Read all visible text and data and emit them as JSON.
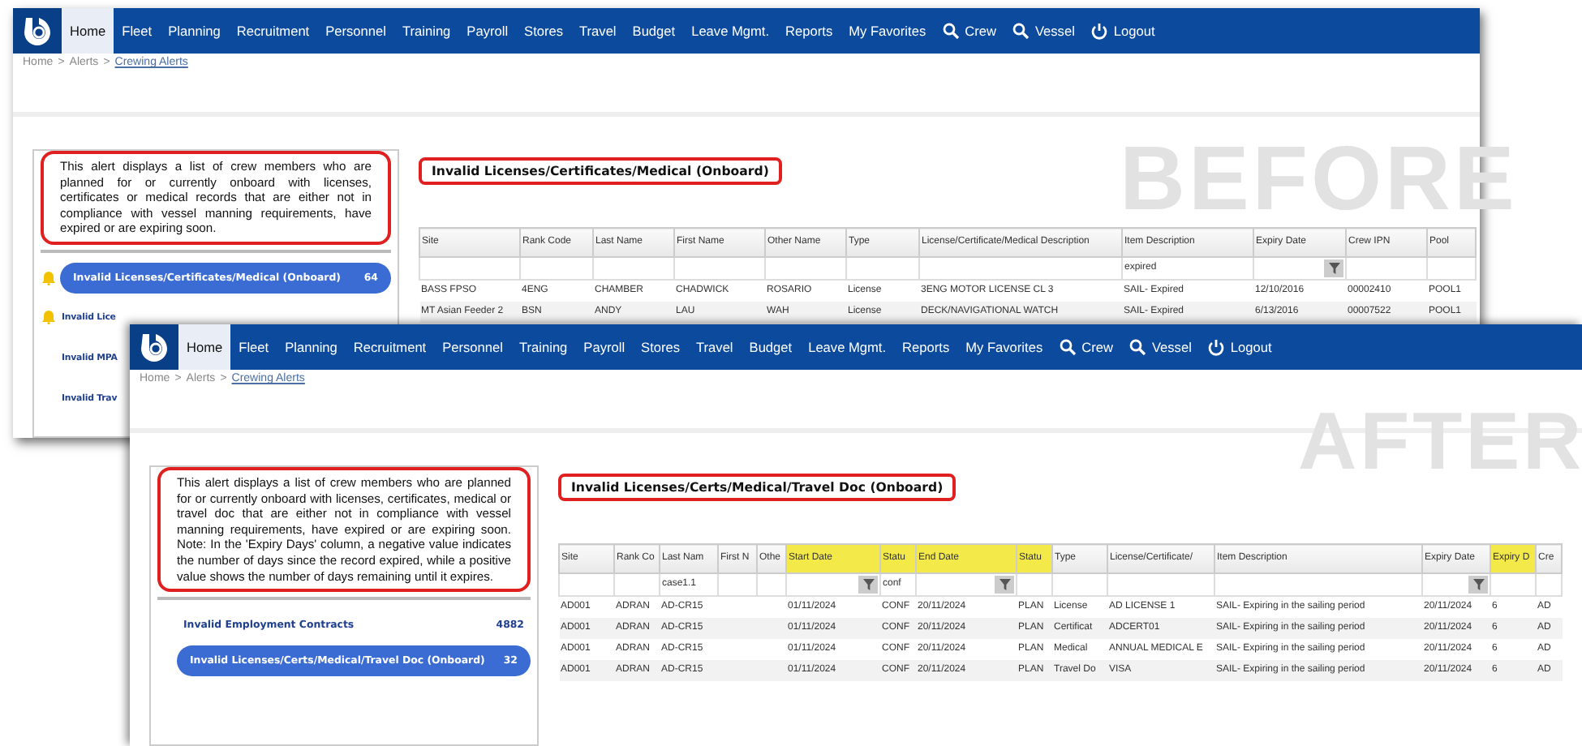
{
  "stamps": [
    {
      "kind": "before",
      "text": "BEFORE"
    },
    {
      "kind": "after",
      "text": "AFTER"
    }
  ],
  "windows": [
    {
      "nav": [
        {
          "label": "Home",
          "selected": true,
          "kind": "text"
        },
        {
          "label": "Fleet",
          "selected": false,
          "kind": "text"
        },
        {
          "label": "Planning",
          "selected": false,
          "kind": "text"
        },
        {
          "label": "Recruitment",
          "selected": false,
          "kind": "text"
        },
        {
          "label": "Personnel",
          "selected": false,
          "kind": "text"
        },
        {
          "label": "Training",
          "selected": false,
          "kind": "text"
        },
        {
          "label": "Payroll",
          "selected": false,
          "kind": "text"
        },
        {
          "label": "Stores",
          "selected": false,
          "kind": "text"
        },
        {
          "label": "Travel",
          "selected": false,
          "kind": "text"
        },
        {
          "label": "Budget",
          "selected": false,
          "kind": "text"
        },
        {
          "label": "Leave Mgmt.",
          "selected": false,
          "kind": "text"
        },
        {
          "label": "Reports",
          "selected": false,
          "kind": "text"
        },
        {
          "label": "My Favorites",
          "selected": false,
          "kind": "text"
        },
        {
          "label": "Crew",
          "selected": false,
          "kind": "search"
        },
        {
          "label": "Vessel",
          "selected": false,
          "kind": "search"
        },
        {
          "label": "Logout",
          "selected": false,
          "kind": "logout"
        }
      ],
      "breadcrumb": {
        "items": [
          "Home",
          "Alerts",
          "Crewing Alerts"
        ],
        "separator": ">"
      },
      "description": "This alert displays a list of crew members who are planned for or currently onboard with licenses, certificates or medical records that are either not in compliance with vessel manning requirements, have expired or are expiring soon.",
      "alerts": [
        {
          "label": "Invalid Licenses/Certificates/Medical (Onboard)",
          "count": "64",
          "selected": true,
          "flagged": true
        },
        {
          "label": "Invalid Lice",
          "selected": false,
          "flagged": true
        },
        {
          "label": "Invalid MPA",
          "selected": false,
          "flagged": false
        },
        {
          "label": "Invalid Trav",
          "selected": false,
          "flagged": false
        }
      ],
      "title": "Invalid Licenses/Certificates/Medical (Onboard)",
      "table": {
        "columns": [
          {
            "label": "Site",
            "highlighted": false,
            "filter_button": false
          },
          {
            "label": "Rank Code",
            "highlighted": false,
            "filter_button": false
          },
          {
            "label": "Last Name",
            "highlighted": false,
            "filter_button": false
          },
          {
            "label": "First Name",
            "highlighted": false,
            "filter_button": false
          },
          {
            "label": "Other Name",
            "highlighted": false,
            "filter_button": false
          },
          {
            "label": "Type",
            "highlighted": false,
            "filter_button": false
          },
          {
            "label": "License/Certificate/Medical Description",
            "highlighted": false,
            "filter_button": false
          },
          {
            "label": "Item Description",
            "highlighted": false,
            "filter_button": false,
            "filter": "expired"
          },
          {
            "label": "Expiry Date",
            "highlighted": false,
            "filter_button": true
          },
          {
            "label": "Crew IPN",
            "highlighted": false,
            "filter_button": false
          },
          {
            "label": "Pool",
            "highlighted": false,
            "filter_button": false
          }
        ],
        "rows": [
          [
            "BASS FPSO",
            "4ENG",
            "CHAMBER",
            "CHADWICK",
            "ROSARIO",
            "License",
            "3ENG MOTOR LICENSE CL 3",
            "SAIL- Expired",
            "12/10/2016",
            "00002410",
            "POOL1"
          ],
          [
            "MT Asian Feeder 2",
            "BSN",
            "ANDY",
            "LAU",
            "WAH",
            "License",
            "DECK/NAVIGATIONAL WATCH",
            "SAIL- Expired",
            "6/13/2016",
            "00007522",
            "POOL1"
          ]
        ]
      }
    },
    {
      "nav": [
        {
          "label": "Home",
          "selected": true,
          "kind": "text"
        },
        {
          "label": "Fleet",
          "selected": false,
          "kind": "text"
        },
        {
          "label": "Planning",
          "selected": false,
          "kind": "text"
        },
        {
          "label": "Recruitment",
          "selected": false,
          "kind": "text"
        },
        {
          "label": "Personnel",
          "selected": false,
          "kind": "text"
        },
        {
          "label": "Training",
          "selected": false,
          "kind": "text"
        },
        {
          "label": "Payroll",
          "selected": false,
          "kind": "text"
        },
        {
          "label": "Stores",
          "selected": false,
          "kind": "text"
        },
        {
          "label": "Travel",
          "selected": false,
          "kind": "text"
        },
        {
          "label": "Budget",
          "selected": false,
          "kind": "text"
        },
        {
          "label": "Leave Mgmt.",
          "selected": false,
          "kind": "text"
        },
        {
          "label": "Reports",
          "selected": false,
          "kind": "text"
        },
        {
          "label": "My Favorites",
          "selected": false,
          "kind": "text"
        },
        {
          "label": "Crew",
          "selected": false,
          "kind": "search"
        },
        {
          "label": "Vessel",
          "selected": false,
          "kind": "search"
        },
        {
          "label": "Logout",
          "selected": false,
          "kind": "logout"
        }
      ],
      "breadcrumb": {
        "items": [
          "Home",
          "Alerts",
          "Crewing Alerts"
        ],
        "separator": ">"
      },
      "description": "This alert displays a list of crew members who are planned for or currently onboard with licenses, certificates, medical or travel doc that are either not in compliance with vessel manning requirements, have expired or are expiring soon. Note: In the 'Expiry Days' column, a negative value indicates the number of days since the record expired, while a positive value shows the number of days remaining until it expires.",
      "alerts": [
        {
          "label": "Invalid Employment Contracts",
          "count": "4882",
          "selected": false,
          "flagged": false
        },
        {
          "label": "Invalid Licenses/Certs/Medical/Travel Doc (Onboard)",
          "count": "32",
          "selected": true,
          "flagged": false
        }
      ],
      "title": "Invalid Licenses/Certs/Medical/Travel Doc (Onboard)",
      "table": {
        "columns": [
          {
            "label": "Site",
            "highlighted": false,
            "filter_button": false
          },
          {
            "label": "Rank Co",
            "highlighted": false,
            "filter_button": false
          },
          {
            "label": "Last Nam",
            "highlighted": false,
            "filter_button": false,
            "filter": "case1.1"
          },
          {
            "label": "First N",
            "highlighted": false,
            "filter_button": false
          },
          {
            "label": "Othe",
            "highlighted": false,
            "filter_button": false
          },
          {
            "label": "Start Date",
            "highlighted": true,
            "filter_button": true
          },
          {
            "label": "Statu",
            "highlighted": true,
            "filter_button": false,
            "filter": "conf"
          },
          {
            "label": "End Date",
            "highlighted": true,
            "filter_button": true
          },
          {
            "label": "Statu",
            "highlighted": true,
            "filter_button": false
          },
          {
            "label": "Type",
            "highlighted": false,
            "filter_button": false
          },
          {
            "label": "License/Certificate/",
            "highlighted": false,
            "filter_button": false
          },
          {
            "label": "Item Description",
            "highlighted": false,
            "filter_button": false
          },
          {
            "label": "Expiry Date",
            "highlighted": false,
            "filter_button": true
          },
          {
            "label": "Expiry D",
            "highlighted": true,
            "filter_button": false
          },
          {
            "label": "Cre",
            "highlighted": false,
            "filter_button": false
          }
        ],
        "rows": [
          [
            "AD001",
            "ADRAN",
            "AD-CR15",
            "",
            "",
            "01/11/2024",
            "CONF",
            "20/11/2024",
            "PLAN",
            "License",
            "AD LICENSE 1",
            "SAIL- Expiring in the sailing period",
            "20/11/2024",
            "6",
            "AD"
          ],
          [
            "AD001",
            "ADRAN",
            "AD-CR15",
            "",
            "",
            "01/11/2024",
            "CONF",
            "20/11/2024",
            "PLAN",
            "Certificat",
            "ADCERT01",
            "SAIL- Expiring in the sailing period",
            "20/11/2024",
            "6",
            "AD"
          ],
          [
            "AD001",
            "ADRAN",
            "AD-CR15",
            "",
            "",
            "01/11/2024",
            "CONF",
            "20/11/2024",
            "PLAN",
            "Medical",
            "ANNUAL MEDICAL E",
            "SAIL- Expiring in the sailing period",
            "20/11/2024",
            "6",
            "AD"
          ],
          [
            "AD001",
            "ADRAN",
            "AD-CR15",
            "",
            "",
            "01/11/2024",
            "CONF",
            "20/11/2024",
            "PLAN",
            "Travel Do",
            "VISA",
            "SAIL- Expiring in the sailing period",
            "20/11/2024",
            "6",
            "AD"
          ]
        ]
      }
    }
  ]
}
